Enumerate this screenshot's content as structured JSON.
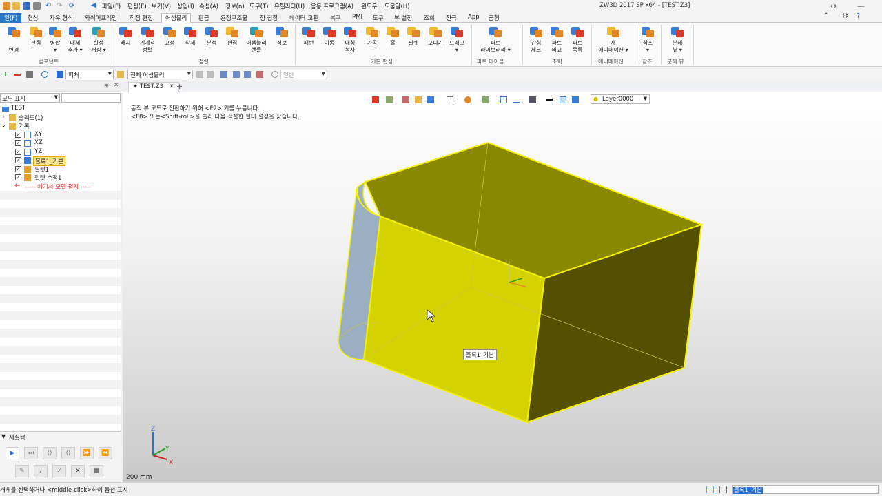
{
  "app": {
    "title": "ZW3D 2017 SP x64 - [TEST.Z3]"
  },
  "menu": [
    "파일(F)",
    "편집(E)",
    "보기(V)",
    "삽입(I)",
    "속성(A)",
    "정보(n)",
    "도구(T)",
    "유틸리티(U)",
    "응용 프로그램(A)",
    "윈도우",
    "도움말(H)"
  ],
  "ribbon_tabs": {
    "file": "일(F)",
    "items": [
      "형상",
      "자유 형식",
      "와이어프레임",
      "직접 편집",
      "어셈블리",
      "판금",
      "용접구조물",
      "점 집합",
      "데이터 교환",
      "복구",
      "PMI",
      "도구",
      "뷰 설정",
      "조회",
      "전극",
      "App",
      "금형"
    ],
    "active_index": 4
  },
  "ribbon": {
    "buttons": [
      {
        "label": "",
        "label2": "변경"
      },
      {
        "label": "편집",
        "label2": ""
      },
      {
        "label": "병합",
        "label2": "▾"
      },
      {
        "label": "대체",
        "label2": "추가 ▾"
      },
      {
        "label": "설정",
        "label2": "저장 ▾"
      },
      {
        "label": "배치",
        "label2": ""
      },
      {
        "label": "기계적",
        "label2": "정렬"
      },
      {
        "label": "고정",
        "label2": ""
      },
      {
        "label": "삭제",
        "label2": ""
      },
      {
        "label": "분석",
        "label2": ""
      },
      {
        "label": "편집",
        "label2": ""
      },
      {
        "label": "어셈블리",
        "label2": "핸들"
      },
      {
        "label": "정보",
        "label2": ""
      },
      {
        "label": "패턴",
        "label2": ""
      },
      {
        "label": "이동",
        "label2": ""
      },
      {
        "label": "대칭",
        "label2": "복사"
      },
      {
        "label": "가공",
        "label2": ""
      },
      {
        "label": "홀",
        "label2": ""
      },
      {
        "label": "필렛",
        "label2": ""
      },
      {
        "label": "모따기",
        "label2": ""
      },
      {
        "label": "드래그",
        "label2": "▾"
      },
      {
        "label": "파트",
        "label2": "라이브러리 ▾"
      },
      {
        "label": "간섭",
        "label2": "체크"
      },
      {
        "label": "파트",
        "label2": "비교"
      },
      {
        "label": "파트",
        "label2": "목록"
      },
      {
        "label": "새",
        "label2": "애니메이션 ▾"
      },
      {
        "label": "참조",
        "label2": "▾"
      },
      {
        "label": "분해",
        "label2": "뷰 ▾"
      }
    ],
    "groups": [
      "컴포넌트",
      "정렬",
      "기본 편집",
      "파트 테이블",
      "조회",
      "애니메이션",
      "참조",
      "분해 뷰"
    ]
  },
  "toolbar2": {
    "filter_value": "피처",
    "assembly_value": "전체 어셈블리",
    "general_value": "일반"
  },
  "left_panel": {
    "filter_select": "모두 표시",
    "tree": [
      {
        "label": "TEST",
        "level": 0
      },
      {
        "label": "솔리드(1)",
        "level": 1
      },
      {
        "label": "기록",
        "level": 1
      },
      {
        "label": "XY",
        "level": 2
      },
      {
        "label": "XZ",
        "level": 2
      },
      {
        "label": "YZ",
        "level": 2
      },
      {
        "label": "블록1_기본",
        "level": 2
      },
      {
        "label": "필렛1",
        "level": 2
      },
      {
        "label": "필렛 수정1",
        "level": 2
      },
      {
        "label": "----- 여기서 모델 정지 -----",
        "level": 2
      }
    ],
    "playback_label": "재실행"
  },
  "document": {
    "tab": "TEST.Z3"
  },
  "viewport": {
    "hint1": "동적 뷰 모드로 전환하기 위해 <F2> 키를 누릅니다.",
    "hint2": "<F8> 또는<Shift-roll>을 눌러 다음 적절한 필터 설정을 찾습니다.",
    "layer": "Layer0000",
    "tooltip": "블록1_기본",
    "scale": "200 mm",
    "triad": {
      "x": "X",
      "y": "Y",
      "z": "Z"
    }
  },
  "status": {
    "text": "개체를 선택하거나 <middle-click>하여 옵션 표시",
    "input_value": "블록1_기본"
  },
  "colors": {
    "accent": "#2b78c5",
    "solid_face": "#d4d200",
    "solid_edge": "#f5f000",
    "stop_marker": "#d42020"
  }
}
